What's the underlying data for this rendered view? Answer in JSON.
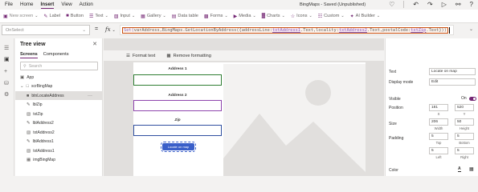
{
  "menu": [
    "File",
    "Home",
    "Insert",
    "View",
    "Action"
  ],
  "menu_active": "Insert",
  "app_title": "BingMaps - Saved (Unpublished)",
  "ribbon": [
    {
      "label": "New screen",
      "icon": "new-screen-icon",
      "dropdown": true
    },
    {
      "label": "Label",
      "icon": "label-icon",
      "dropdown": false
    },
    {
      "label": "Button",
      "icon": "button-icon",
      "dropdown": false
    },
    {
      "label": "Text",
      "icon": "text-icon",
      "dropdown": true
    },
    {
      "label": "Input",
      "icon": "input-icon",
      "dropdown": true
    },
    {
      "label": "Gallery",
      "icon": "gallery-icon",
      "dropdown": true
    },
    {
      "label": "Data table",
      "icon": "data-table-icon",
      "dropdown": false
    },
    {
      "label": "Forms",
      "icon": "forms-icon",
      "dropdown": true
    },
    {
      "label": "Media",
      "icon": "media-icon",
      "dropdown": true
    },
    {
      "label": "Charts",
      "icon": "charts-icon",
      "dropdown": true
    },
    {
      "label": "Icons",
      "icon": "icons-icon",
      "dropdown": true
    },
    {
      "label": "Custom",
      "icon": "custom-icon",
      "dropdown": true
    },
    {
      "label": "AI Builder",
      "icon": "ai-builder-icon",
      "dropdown": true
    }
  ],
  "formula_bar": {
    "property": "OnSelect",
    "equals": "=",
    "fx": "fx",
    "formula": {
      "p1": "Set(",
      "p2": "varAddress,BingMaps.GetLocationByAddress({addressLine:",
      "c1": "txtAddress1",
      "p3": ".Text,locality:",
      "c2": "txtAddress2",
      "p4": ".Text,postalCode:",
      "c3": "txtZip",
      "p5": ".Text}))"
    }
  },
  "subbar": {
    "format_text": "Format text",
    "remove_formatting": "Remove formatting"
  },
  "tree": {
    "title": "Tree view",
    "tabs": [
      "Screens",
      "Components"
    ],
    "search_placeholder": "Search",
    "items": [
      {
        "label": "App",
        "icon": "app-icon",
        "indent": 0,
        "selected": false
      },
      {
        "label": "scrBingMap",
        "icon": "screen-icon",
        "indent": 0,
        "selected": false
      },
      {
        "label": "btnLocateAddress",
        "icon": "button-icon",
        "indent": 1,
        "selected": true
      },
      {
        "label": "lblZip",
        "icon": "label-icon",
        "indent": 1,
        "selected": false
      },
      {
        "label": "txtZip",
        "icon": "input-icon",
        "indent": 1,
        "selected": false
      },
      {
        "label": "lblAddress2",
        "icon": "label-icon",
        "indent": 1,
        "selected": false
      },
      {
        "label": "txtAddress2",
        "icon": "input-icon",
        "indent": 1,
        "selected": false
      },
      {
        "label": "lblAddress1",
        "icon": "label-icon",
        "indent": 1,
        "selected": false
      },
      {
        "label": "txtAddress1",
        "icon": "input-icon",
        "indent": 1,
        "selected": false
      },
      {
        "label": "imgBingMap",
        "icon": "image-icon",
        "indent": 1,
        "selected": false
      }
    ]
  },
  "canvas": {
    "address1_label": "Address 1",
    "address2_label": "Address 2",
    "zip_label": "Zip",
    "locate_button": "Locate on map",
    "colors": {
      "address1_border": "#2e7d32",
      "address2_border": "#8e44ad",
      "zip_border": "#2f4f9f",
      "button": "#3a5fc9"
    }
  },
  "properties": {
    "text_label": "Text",
    "text_value": "Locate on map",
    "display_mode_label": "Display mode",
    "display_mode_value": "Edit",
    "visible_label": "Visible",
    "visible_value": "On",
    "position_label": "Position",
    "position_x": "181",
    "position_y": "520",
    "x_label": "X",
    "y_label": "Y",
    "size_label": "Size",
    "size_width": "206",
    "size_height": "50",
    "width_label": "Width",
    "height_label": "Height",
    "padding_label": "Padding",
    "pad_top": "5",
    "pad_bottom": "5",
    "pad_left": "5",
    "pad_right": "5",
    "top_label": "Top",
    "bottom_label": "Bottom",
    "left_label": "Left",
    "right_label": "Right",
    "color_label": "Color"
  }
}
